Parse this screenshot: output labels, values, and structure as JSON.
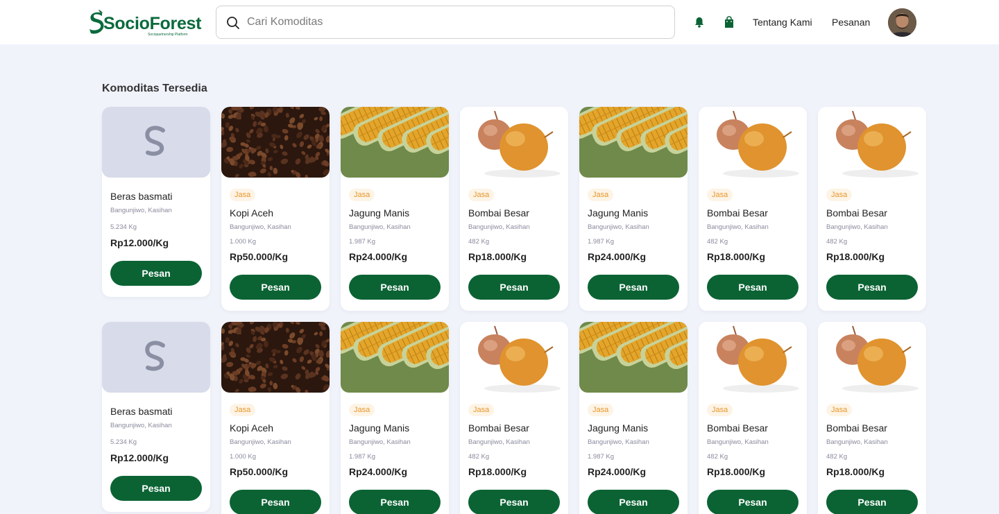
{
  "brand": {
    "name": "SocioForest",
    "tagline": "Sociopartnership Platform",
    "primary_color": "#0b6334",
    "badge_color": "#e8962a"
  },
  "header": {
    "search_placeholder": "Cari Komoditas",
    "nav_icons": [
      "bell-icon",
      "shopping-bag-icon"
    ],
    "links": [
      "Tentang Kami",
      "Pesanan"
    ]
  },
  "section_title": "Komoditas Tersedia",
  "products": [
    {
      "image": "placeholder-logo",
      "badge": "",
      "name": "Beras basmati",
      "location": "Bangunjiwo, Kasihan",
      "stock": "5.234 Kg",
      "price": "Rp12.000/Kg",
      "button": "Pesan"
    },
    {
      "image": "coffee-beans",
      "badge": "Jasa",
      "name": "Kopi Aceh",
      "location": "Bangunjiwo, Kasihan",
      "stock": "1.000 Kg",
      "price": "Rp50.000/Kg",
      "button": "Pesan"
    },
    {
      "image": "corn",
      "badge": "Jasa",
      "name": "Jagung Manis",
      "location": "Bangunjiwo, Kasihan",
      "stock": "1.987 Kg",
      "price": "Rp24.000/Kg",
      "button": "Pesan"
    },
    {
      "image": "onion",
      "badge": "Jasa",
      "name": "Bombai Besar",
      "location": "Bangunjiwo, Kasihan",
      "stock": "482 Kg",
      "price": "Rp18.000/Kg",
      "button": "Pesan"
    },
    {
      "image": "corn",
      "badge": "Jasa",
      "name": "Jagung Manis",
      "location": "Bangunjiwo, Kasihan",
      "stock": "1.987 Kg",
      "price": "Rp24.000/Kg",
      "button": "Pesan"
    },
    {
      "image": "onion",
      "badge": "Jasa",
      "name": "Bombai Besar",
      "location": "Bangunjiwo, Kasihan",
      "stock": "482 Kg",
      "price": "Rp18.000/Kg",
      "button": "Pesan"
    },
    {
      "image": "onion",
      "badge": "Jasa",
      "name": "Bombai Besar",
      "location": "Bangunjiwo, Kasihan",
      "stock": "482 Kg",
      "price": "Rp18.000/Kg",
      "button": "Pesan"
    },
    {
      "image": "placeholder-logo",
      "badge": "",
      "name": "Beras basmati",
      "location": "Bangunjiwo, Kasihan",
      "stock": "5.234 Kg",
      "price": "Rp12.000/Kg",
      "button": "Pesan"
    },
    {
      "image": "coffee-beans",
      "badge": "Jasa",
      "name": "Kopi Aceh",
      "location": "Bangunjiwo, Kasihan",
      "stock": "1.000 Kg",
      "price": "Rp50.000/Kg",
      "button": "Pesan"
    },
    {
      "image": "corn",
      "badge": "Jasa",
      "name": "Jagung Manis",
      "location": "Bangunjiwo, Kasihan",
      "stock": "1.987 Kg",
      "price": "Rp24.000/Kg",
      "button": "Pesan"
    },
    {
      "image": "onion",
      "badge": "Jasa",
      "name": "Bombai Besar",
      "location": "Bangunjiwo, Kasihan",
      "stock": "482 Kg",
      "price": "Rp18.000/Kg",
      "button": "Pesan"
    },
    {
      "image": "corn",
      "badge": "Jasa",
      "name": "Jagung Manis",
      "location": "Bangunjiwo, Kasihan",
      "stock": "1.987 Kg",
      "price": "Rp24.000/Kg",
      "button": "Pesan"
    },
    {
      "image": "onion",
      "badge": "Jasa",
      "name": "Bombai Besar",
      "location": "Bangunjiwo, Kasihan",
      "stock": "482 Kg",
      "price": "Rp18.000/Kg",
      "button": "Pesan"
    },
    {
      "image": "onion",
      "badge": "Jasa",
      "name": "Bombai Besar",
      "location": "Bangunjiwo, Kasihan",
      "stock": "482 Kg",
      "price": "Rp18.000/Kg",
      "button": "Pesan"
    }
  ]
}
